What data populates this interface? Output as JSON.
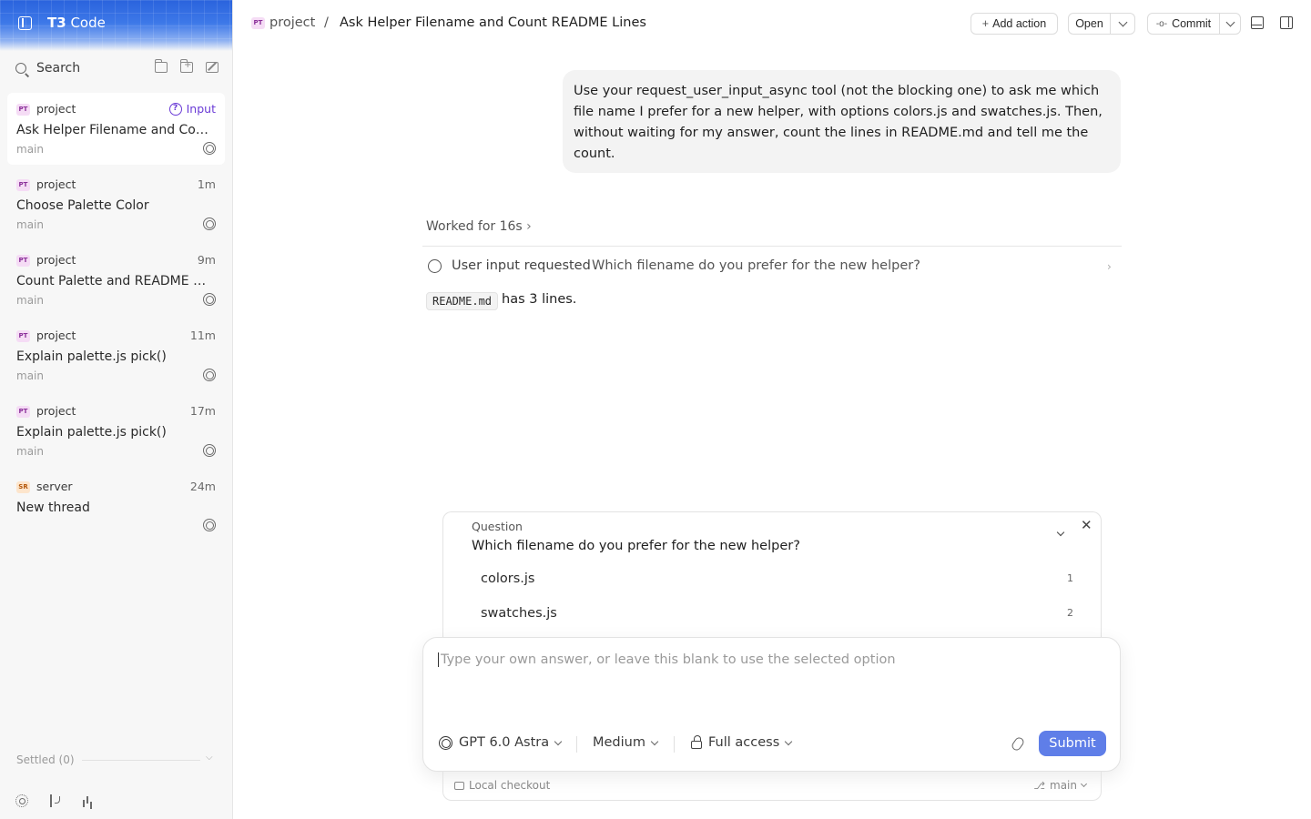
{
  "app": {
    "title_bold": "T3",
    "title_rest": " Code"
  },
  "sidebar": {
    "search_label": "Search",
    "threads": [
      {
        "badge": "PT",
        "project": "project",
        "status": "Input",
        "title": "Ask Helper Filename and Count README Lines",
        "branch": "main"
      },
      {
        "badge": "PT",
        "project": "project",
        "time": "1m",
        "title": "Choose Palette Color",
        "branch": "main"
      },
      {
        "badge": "PT",
        "project": "project",
        "time": "9m",
        "title": "Count Palette and README Lines",
        "branch": "main"
      },
      {
        "badge": "PT",
        "project": "project",
        "time": "11m",
        "title": "Explain palette.js pick()",
        "branch": "main"
      },
      {
        "badge": "PT",
        "project": "project",
        "time": "17m",
        "title": "Explain palette.js pick()",
        "branch": "main"
      },
      {
        "badge": "SR",
        "project": "server",
        "time": "24m",
        "title": "New thread",
        "branch": ""
      }
    ],
    "settled_label": "Settled (0)"
  },
  "header": {
    "badge": "PT",
    "project": "project",
    "separator": "/",
    "title": "Ask Helper Filename and Count README Lines",
    "add_action_label": "Add action",
    "open_label": "Open",
    "commit_label": "Commit"
  },
  "conversation": {
    "user_message": "Use your request_user_input_async tool (not the blocking one) to ask me which file name I prefer for a new helper, with options colors.js and swatches.js. Then, without waiting for my answer, count the lines in README.md and tell me the count.",
    "worked_label": "Worked for 16s",
    "request_label": "User input requested",
    "request_text": "Which filename do you prefer for the new helper?",
    "reply_code": "README.md",
    "reply_text": "has 3 lines."
  },
  "question": {
    "heading": "Question",
    "text": "Which filename do you prefer for the new helper?",
    "options": [
      {
        "label": "colors.js",
        "key": "1"
      },
      {
        "label": "swatches.js",
        "key": "2"
      }
    ]
  },
  "composer": {
    "placeholder": "Type your own answer, or leave this blank to use the selected option",
    "model": "GPT 6.0 Astra",
    "effort": "Medium",
    "access": "Full access",
    "submit_label": "Submit"
  },
  "footer": {
    "checkout_label": "Local checkout",
    "branch": "main"
  },
  "colors": {
    "accent": "#5f7ee8",
    "input_status": "#6a3bd6"
  }
}
